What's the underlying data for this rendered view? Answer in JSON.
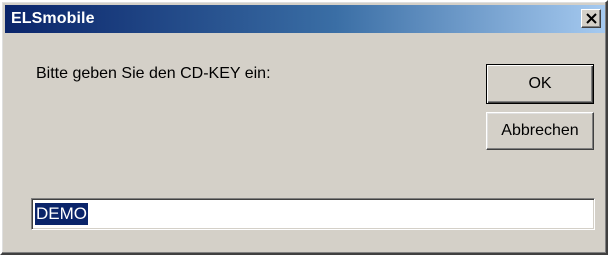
{
  "window": {
    "title": "ELSmobile",
    "close_icon": "close-icon"
  },
  "dialog": {
    "prompt": "Bitte geben Sie den CD-KEY ein:",
    "ok_label": "OK",
    "cancel_label": "Abbrechen",
    "cdkey_value": "DEMO",
    "cdkey_selected": true
  },
  "colors": {
    "title_bar_start": "#0a246a",
    "title_bar_end": "#a6caf0",
    "face": "#d4d0c8",
    "selection": "#0a246a"
  }
}
